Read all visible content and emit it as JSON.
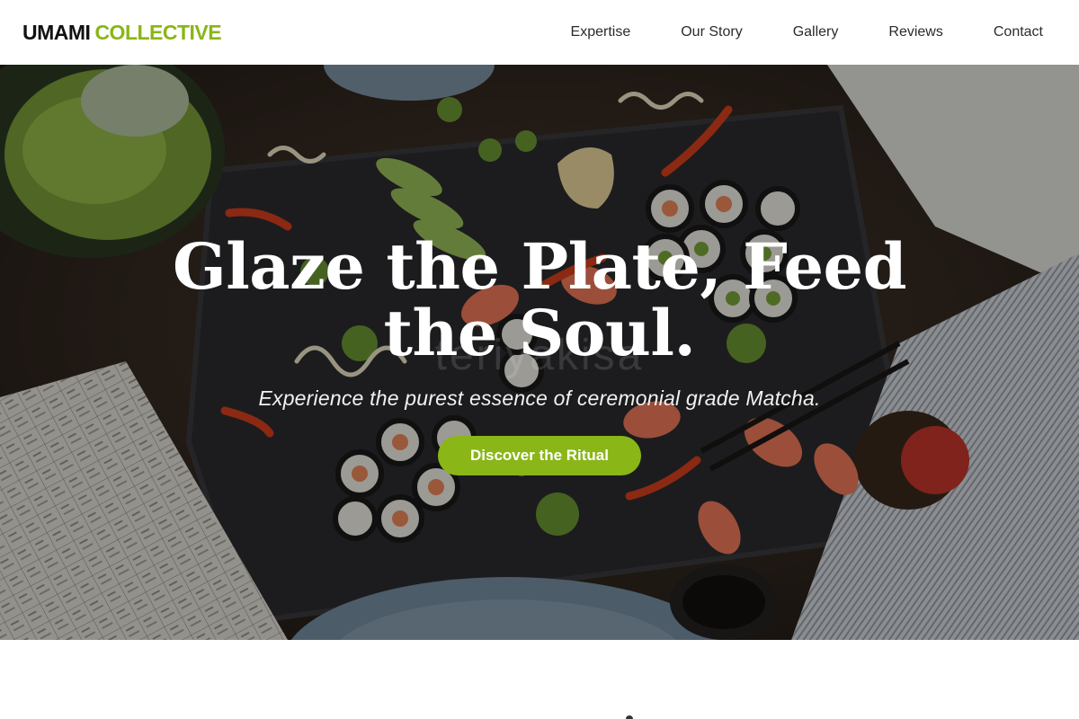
{
  "brand": {
    "name_primary": "UMAMI",
    "name_secondary": "COLLECTIVE",
    "accent_color": "#8ab617"
  },
  "nav": {
    "items": [
      {
        "label": "Expertise"
      },
      {
        "label": "Our Story"
      },
      {
        "label": "Gallery"
      },
      {
        "label": "Reviews"
      },
      {
        "label": "Contact"
      }
    ]
  },
  "hero": {
    "title": "Glaze the Plate, Feed the Soul.",
    "subtitle": "Experience the purest essence of ceremonial grade Matcha.",
    "cta_label": "Discover the Ritual",
    "watermark_text": "teriyakisa",
    "background_image": "overhead-sushi-platter-photo"
  }
}
